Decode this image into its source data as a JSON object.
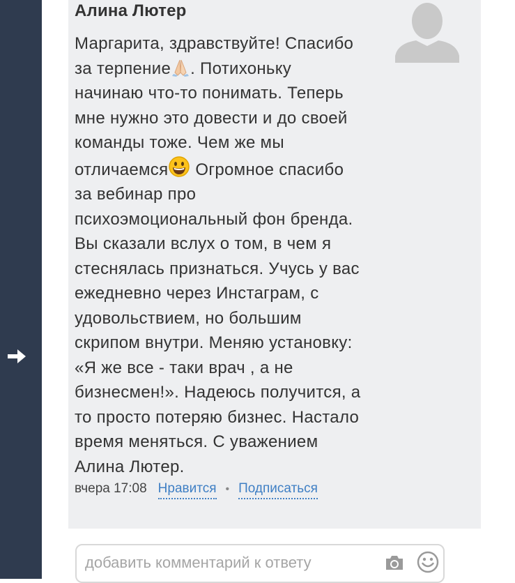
{
  "sidebar": {
    "arrow_icon": "arrow-right-icon"
  },
  "comment": {
    "author": "Алина Лютер",
    "avatar_icon": "user-silhouette-icon",
    "lines": [
      "Маргарита, здравствуйте! Спасибо",
      "за терпение",
      ". Потихоньку",
      "начинаю что-то понимать. Теперь",
      "мне нужно это довести и до своей",
      "команды тоже. Чем же мы",
      "отличаемся",
      " Огромное спасибо",
      "за вебинар про",
      "психоэмоциональный фон бренда.",
      "Вы сказали вслух о том, в чем я",
      "стеснялась признаться. Учусь у вас",
      "ежедневно через Инстаграм, с",
      "удовольствием, но большим",
      "скрипом внутри. Меняю установку:",
      "«Я же все - таки врач , а не",
      "бизнесмен!». Надеюсь получится, а",
      "то просто потеряю бизнес. Настало",
      "время меняться. С уважением",
      "Алина Лютер."
    ],
    "emoji_1": "praying-hands-icon",
    "emoji_2": "grinning-face-icon",
    "time": "вчера 17:08",
    "like_label": "Нравится",
    "separator": "•",
    "subscribe_label": "Подписаться"
  },
  "reply": {
    "placeholder": "добавить комментарий к ответу",
    "camera_icon": "camera-icon",
    "smile_icon": "smile-icon"
  },
  "colors": {
    "sidebar": "#2f3b4f",
    "card": "#eeeff1",
    "link": "#3f7fc4",
    "text": "#333333"
  }
}
